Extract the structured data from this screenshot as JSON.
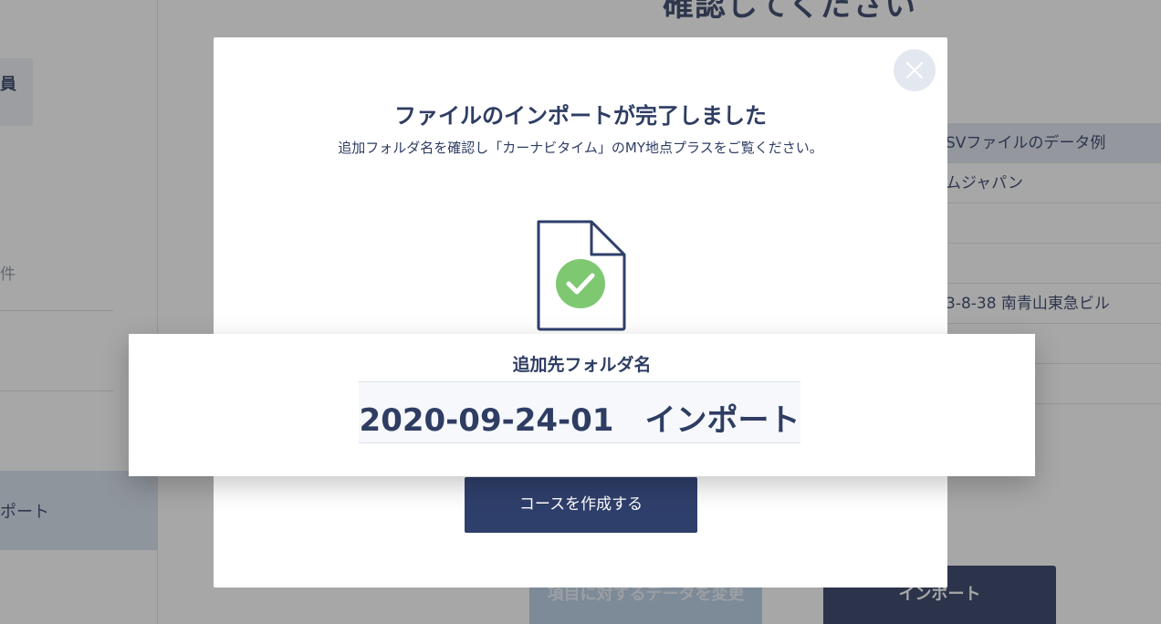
{
  "background": {
    "sidebar": {
      "item_top": "員",
      "count_text": "件",
      "import_item": "ポート"
    },
    "page_title": "確認してください",
    "table_rows": [
      "SVファイルのデータ例",
      "ムジャパン",
      "",
      "",
      "3-8-38 南青山東急ビル",
      "",
      ""
    ],
    "buttons": {
      "change_data": "項目に対するデータを変更",
      "import": "インポート"
    }
  },
  "modal": {
    "title": "ファイルのインポートが完了しました",
    "description": "追加フォルダ名を確認し「カーナビタイム」のMY地点プラスをご覧ください。",
    "folder_label": "追加先フォルダ名",
    "folder_name": "2020-09-24-01　インポート",
    "create_course_button": "コースを作成する",
    "close_icon": "close-icon",
    "file_icon": "file-check-icon",
    "colors": {
      "primary": "#2f3f6b",
      "check": "#7ec872",
      "text": "#2f3d63"
    }
  }
}
